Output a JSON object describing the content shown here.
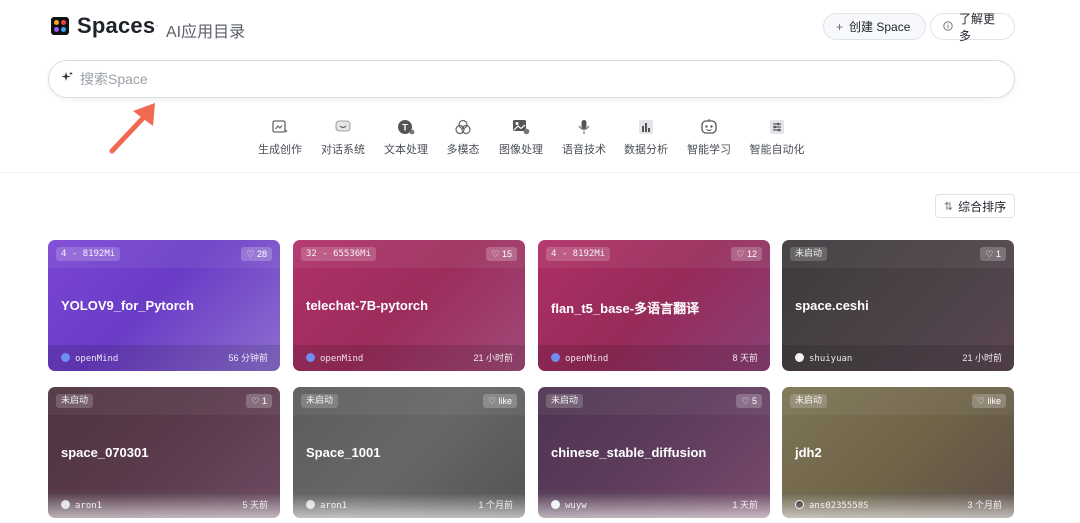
{
  "header": {
    "brand": "Spaces",
    "separator": "·",
    "subtitle": "AI应用目录",
    "create_label": "创建 Space",
    "create_icon": "plus-icon",
    "more_label": "了解更多",
    "more_icon": "info-icon"
  },
  "search": {
    "placeholder": "搜索Space",
    "icon": "sparkle-icon",
    "value": ""
  },
  "categories": [
    {
      "label": "生成创作",
      "icon": "image-generate-icon"
    },
    {
      "label": "对话系统",
      "icon": "chat-icon"
    },
    {
      "label": "文本处理",
      "icon": "text-icon"
    },
    {
      "label": "多模态",
      "icon": "multimodal-icon"
    },
    {
      "label": "图像处理",
      "icon": "image-process-icon"
    },
    {
      "label": "语音技术",
      "icon": "microphone-icon"
    },
    {
      "label": "数据分析",
      "icon": "bar-chart-icon"
    },
    {
      "label": "智能学习",
      "icon": "robot-icon"
    },
    {
      "label": "智能自动化",
      "icon": "sliders-icon"
    }
  ],
  "sort": {
    "label": "综合排序",
    "icon": "sort-icon"
  },
  "cards": [
    {
      "badge": "4 - 8192Mi",
      "likes": "♡ 28",
      "title": "YOLOV9_for_Pytorch",
      "owner": "openMind",
      "time": "56 分钟前",
      "color": "#6b3fc7"
    },
    {
      "badge": "32 - 65536Mi",
      "likes": "♡ 15",
      "title": "telechat-7B-pytorch",
      "owner": "openMind",
      "time": "21 小时前",
      "color": "#a8305f"
    },
    {
      "badge": "4 - 8192Mi",
      "likes": "♡ 12",
      "title": "flan_t5_base-多语言翻译",
      "owner": "openMind",
      "time": "8 天前",
      "color": "#a82d61"
    },
    {
      "badge": "未启动",
      "likes": "♡ 1",
      "title": "space.ceshi",
      "owner": "shuiyuan",
      "time": "21 小时前",
      "color": "#4a4347"
    },
    {
      "badge": "未启动",
      "likes": "♡ 1",
      "title": "space_070301",
      "owner": "aron1",
      "time": "5 天前",
      "color": "#5a3a4a"
    },
    {
      "badge": "未启动",
      "likes": "♡ like",
      "title": "Space_1001",
      "owner": "aron1",
      "time": "1 个月前",
      "color": "#5a5a5a"
    },
    {
      "badge": "未启动",
      "likes": "♡ 5",
      "title": "chinese_stable_diffusion",
      "owner": "wuyw",
      "time": "1 天前",
      "color": "#5a3f58"
    },
    {
      "badge": "未启动",
      "likes": "♡ like",
      "title": "jdh2",
      "owner": "ans0235558S",
      "time": "3 个月前",
      "color": "#6f6448"
    }
  ]
}
